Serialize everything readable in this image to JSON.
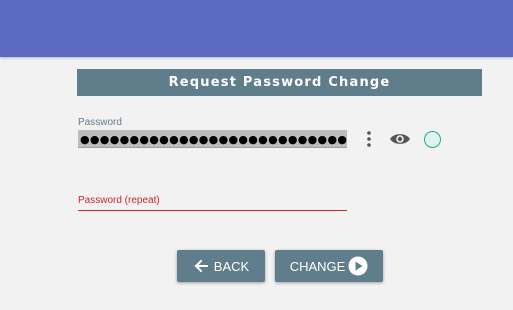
{
  "header": {
    "title": "Request Password Change"
  },
  "password": {
    "label": "Password",
    "value": "●●●●●●●●●●●●●●●●●●●●●●●●●●●●●●●●●●●●"
  },
  "password_repeat": {
    "label": "Password (repeat)",
    "value": ""
  },
  "actions": {
    "back_label": "BACK",
    "change_label": "CHANGE"
  },
  "icons": {
    "options": "kebab-menu-icon",
    "visibility": "eye-icon",
    "strength": "strength-indicator-circle",
    "back": "arrow-left-icon",
    "change": "play-circle-icon"
  },
  "colors": {
    "top_bar": "#5c6bc0",
    "header": "#607d8b",
    "button": "#607d8b",
    "error": "#c62828",
    "strength_border": "#26a69a"
  }
}
